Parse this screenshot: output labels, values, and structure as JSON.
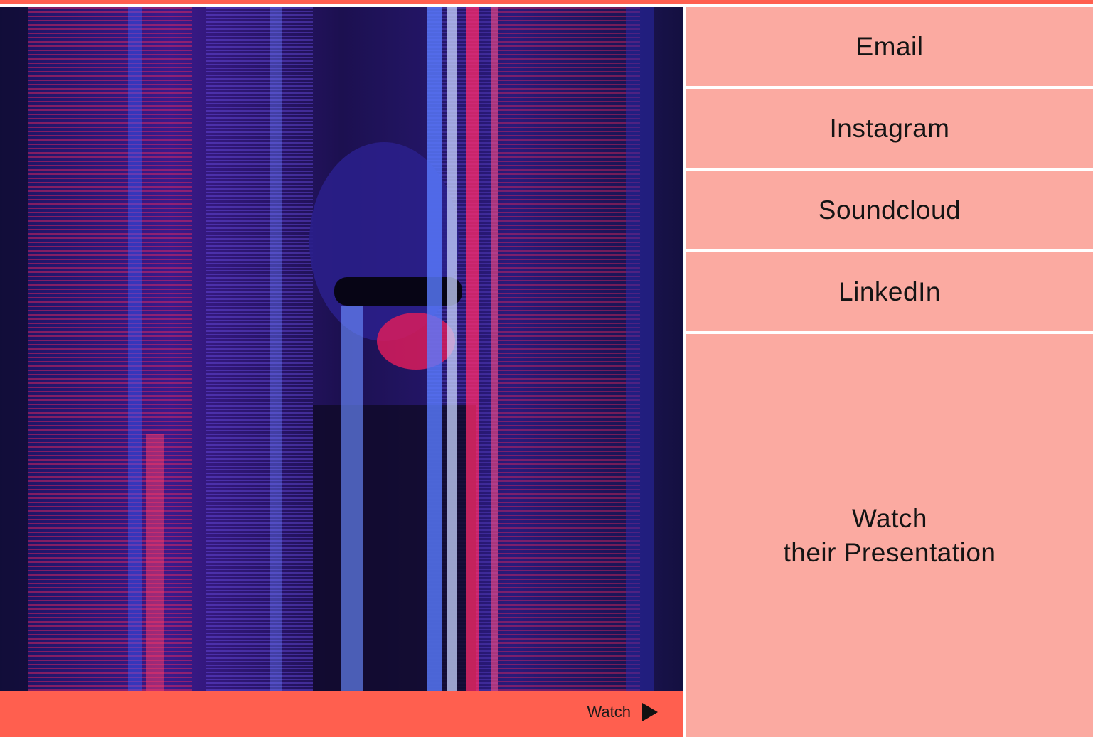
{
  "colors": {
    "accent": "#ff5f4f",
    "link_panel": "#fbaaa1",
    "text": "#141414"
  },
  "photo": {
    "icon": "portrait-photo"
  },
  "watch_bar": {
    "label": "Watch",
    "icon": "play-icon"
  },
  "links": [
    {
      "label": "Email"
    },
    {
      "label": "Instagram"
    },
    {
      "label": "Soundcloud"
    },
    {
      "label": "LinkedIn"
    }
  ],
  "presentation": {
    "line1": "Watch",
    "line2": "their Presentation"
  }
}
